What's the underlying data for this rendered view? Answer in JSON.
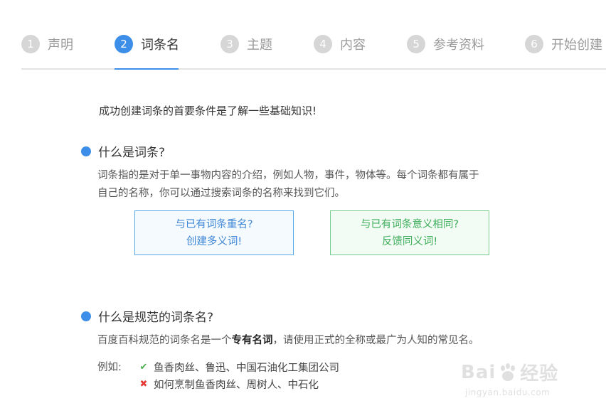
{
  "stepper": {
    "steps": [
      {
        "num": "1",
        "label": "声明"
      },
      {
        "num": "2",
        "label": "词条名"
      },
      {
        "num": "3",
        "label": "主题"
      },
      {
        "num": "4",
        "label": "内容"
      },
      {
        "num": "5",
        "label": "参考资料"
      },
      {
        "num": "6",
        "label": "开始创建"
      }
    ],
    "active_index": 2,
    "accent_color": "#3d8ee8"
  },
  "intro": "成功创建词条的首要条件是了解一些基础知识!",
  "section1": {
    "title": "什么是词条?",
    "para_line1": "词条指的是对于单一事物内容的介绍，例如人物，事件，物体等。每个词条都有属于",
    "para_line2": "自己的名称，你可以通过搜索词条的名称来找到它们。"
  },
  "buttons": {
    "duplicate": {
      "line1": "与已有词条重名?",
      "line2": "创建多义词!",
      "color": "#3d86d6"
    },
    "synonym": {
      "line1": "与已有词条意义相同?",
      "line2": "反馈同义词!",
      "color": "#3eae5b"
    }
  },
  "section2": {
    "title": "什么是规范的词条名?",
    "para_pre": "百度百科规范的词条名是一个",
    "para_bold": "专有名词",
    "para_post": "，请使用正式的全称或最广为人知的常见名。",
    "example_label": "例如:",
    "good_example": "鱼香肉丝、鲁迅、中国石油化工集团公司",
    "bad_example": "如何烹制鱼香肉丝、周树人、中石化",
    "good_icon": "check-icon",
    "bad_icon": "cross-icon"
  },
  "watermark": {
    "main_left": "Bai",
    "main_right": "经验",
    "sub": "jingyan.baidu.com"
  }
}
